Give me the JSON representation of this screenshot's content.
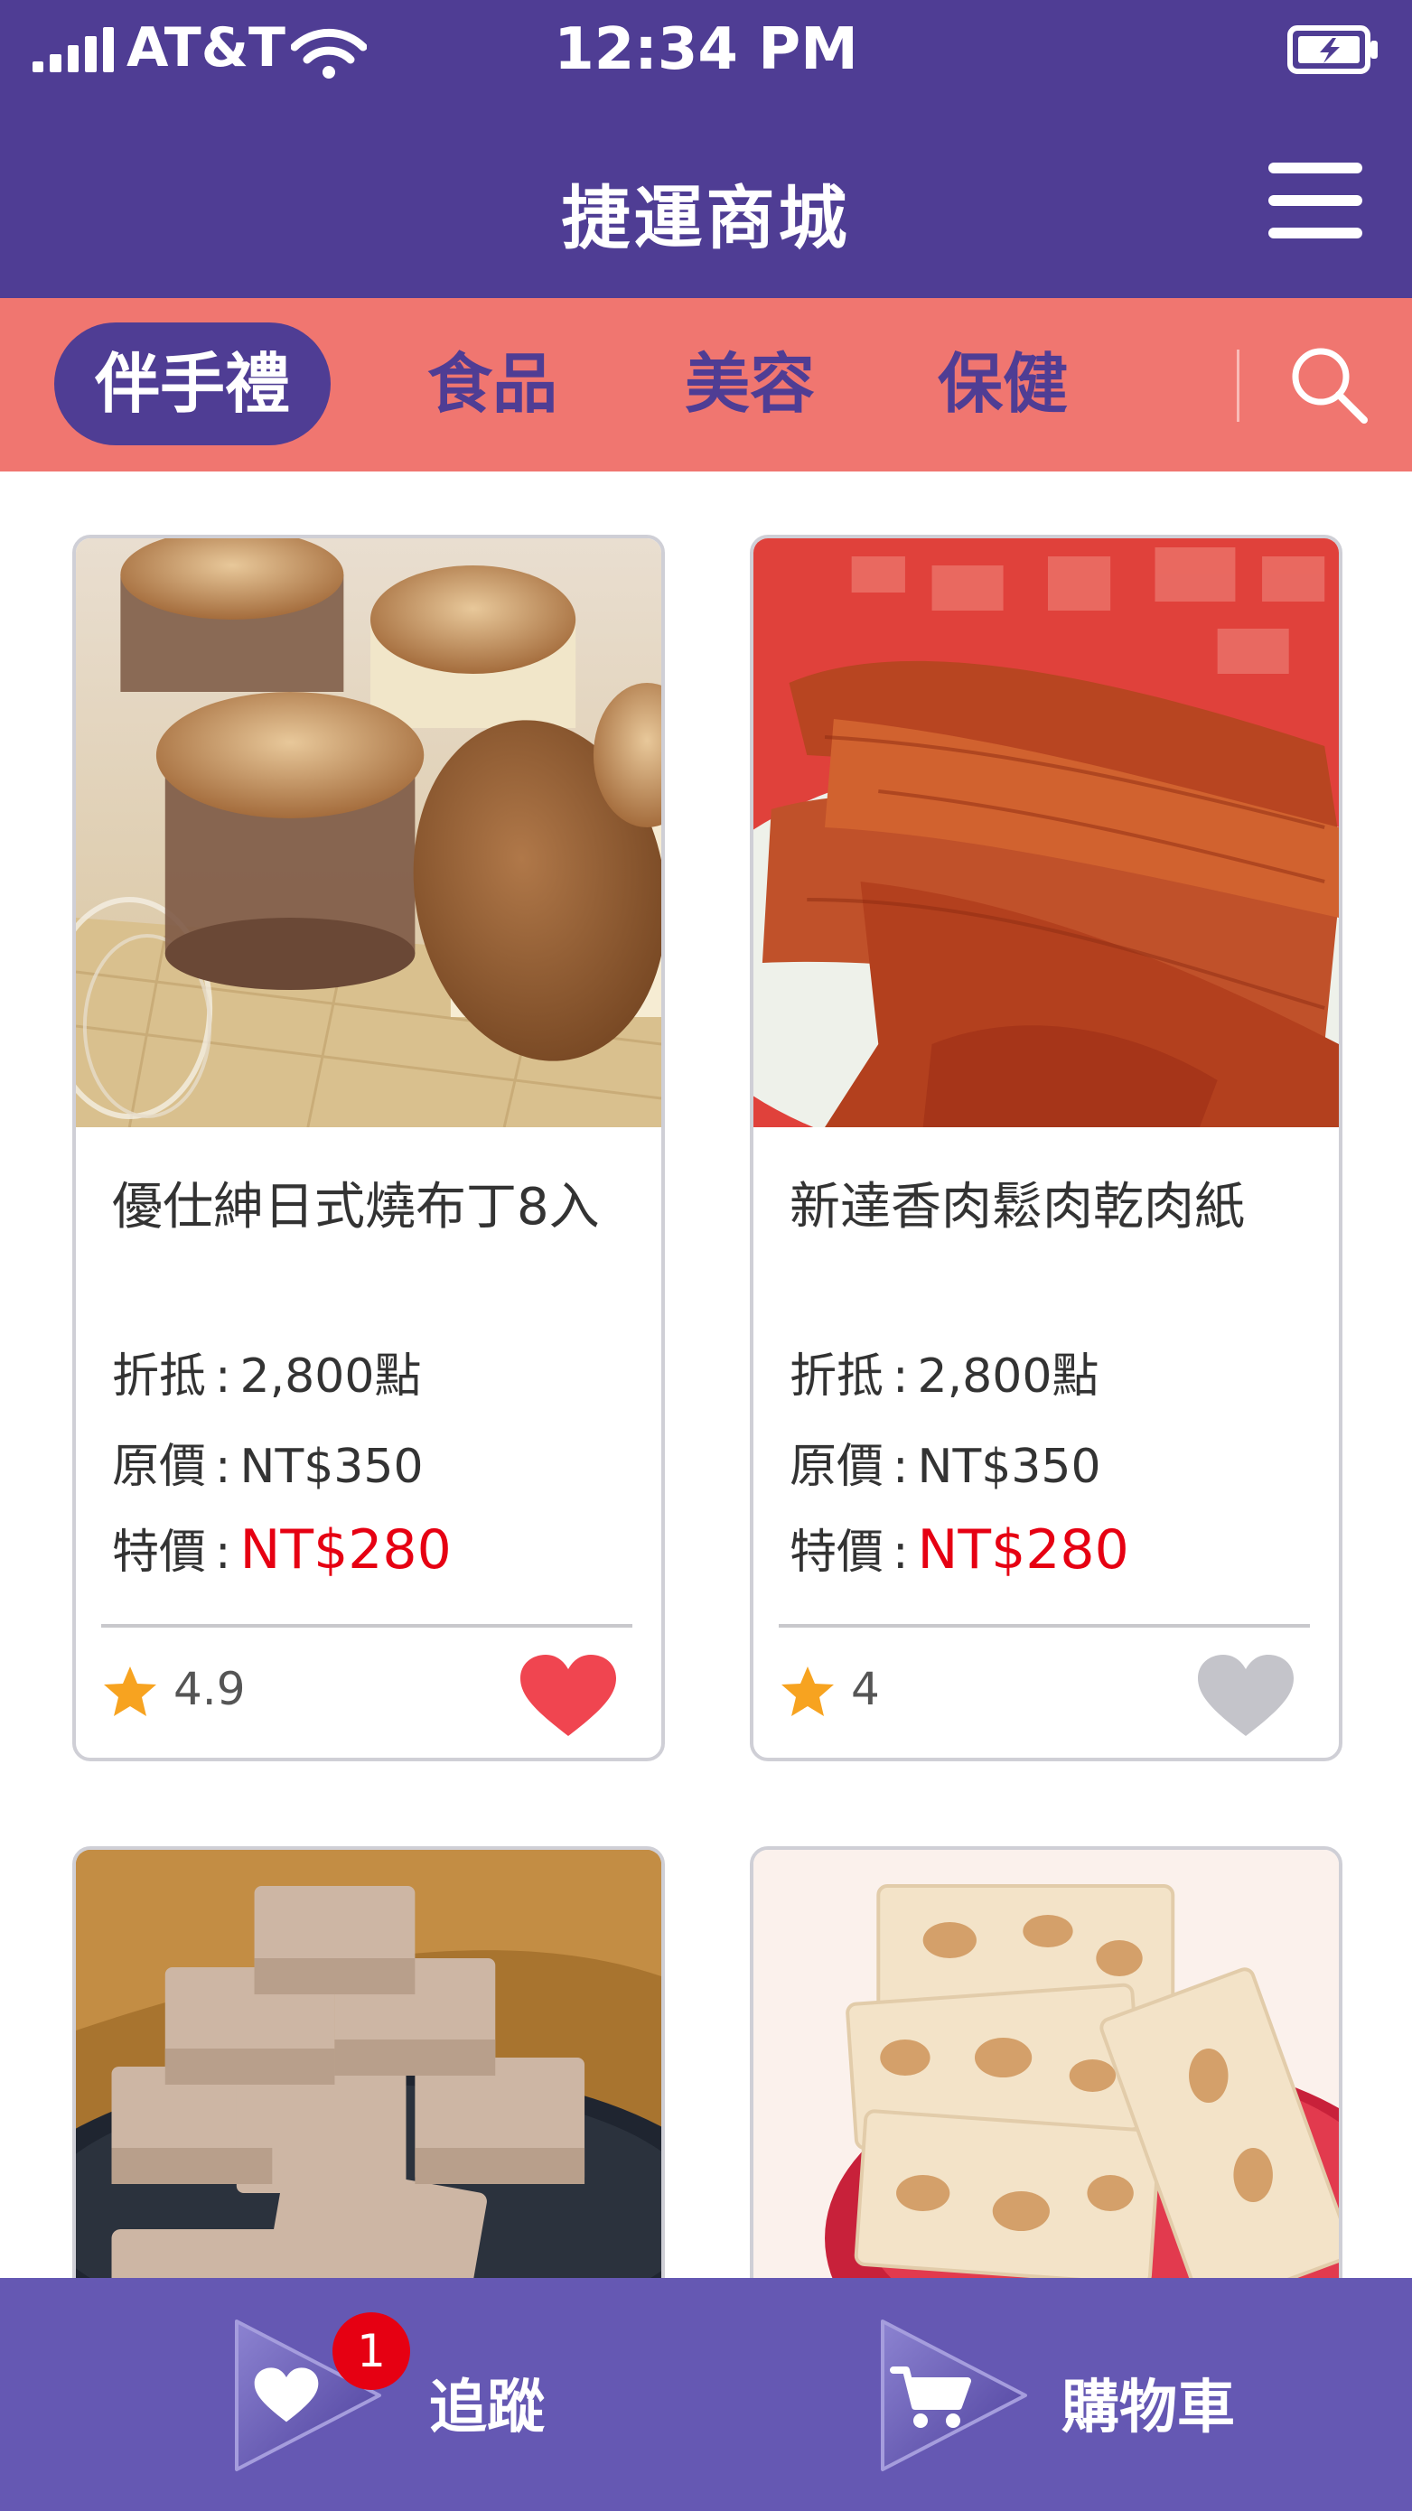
{
  "status_bar": {
    "carrier": "AT&T",
    "time": "12:34 PM"
  },
  "header": {
    "title": "捷運商城"
  },
  "categories": {
    "tabs": [
      {
        "label": "伴手禮",
        "active": true
      },
      {
        "label": "食品",
        "active": false
      },
      {
        "label": "美容",
        "active": false
      },
      {
        "label": "保健",
        "active": false
      }
    ]
  },
  "product_labels": {
    "points": "折抵",
    "original": "原價",
    "sale": "特價",
    "separator": ":"
  },
  "products": [
    {
      "name": "優仕紳日式燒布丁8入",
      "points": "2,800點",
      "original_price": "NT$350",
      "sale_price": "NT$280",
      "rating": "4.9",
      "favorited": true
    },
    {
      "name": "新達香肉鬆肉乾肉紙",
      "points": "2,800點",
      "original_price": "NT$350",
      "sale_price": "NT$280",
      "rating": "4",
      "favorited": false
    }
  ],
  "bottom_nav": {
    "track_label": "追蹤",
    "track_badge": "1",
    "cart_label": "購物車"
  },
  "colors": {
    "primary": "#4f3d94",
    "category_bar": "#f07670",
    "bottom_nav": "#6558b3",
    "sale_price": "#e60012",
    "heart_active": "#f04550",
    "heart_inactive": "#c4c4ca",
    "star": "#f7a320"
  }
}
